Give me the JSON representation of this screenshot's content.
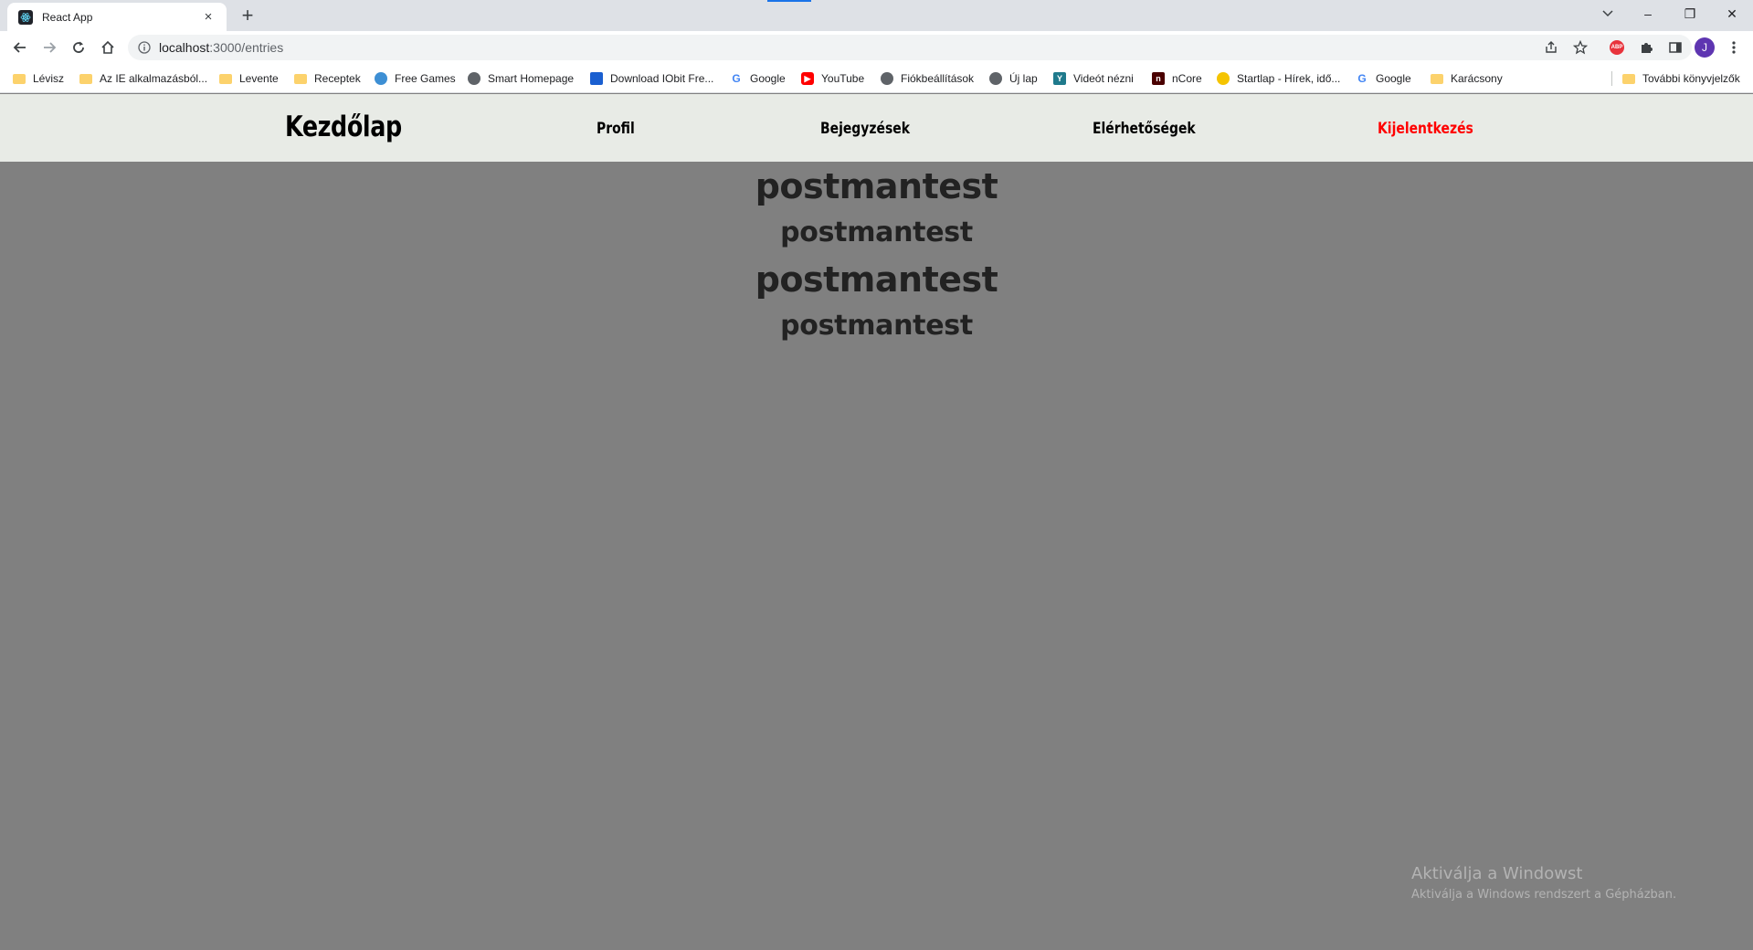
{
  "browser": {
    "tab": {
      "title": "React App",
      "close": "×"
    },
    "new_tab": "+",
    "window_controls": {
      "minimize": "–",
      "restore": "❐",
      "close": "✕"
    },
    "url": {
      "host": "localhost",
      "path": ":3000/entries"
    },
    "profile_initial": "J",
    "abp_label": "ABP",
    "bookmarks": [
      {
        "label": "Lévisz",
        "icon": "folder-icon"
      },
      {
        "label": "Az IE alkalmazásból...",
        "icon": "folder-icon"
      },
      {
        "label": "Levente",
        "icon": "folder-icon"
      },
      {
        "label": "Receptek",
        "icon": "folder-icon"
      },
      {
        "label": "Free Games",
        "icon": "globe-icon"
      },
      {
        "label": "Smart Homepage",
        "icon": "globe-icon"
      },
      {
        "label": "Download IObit Fre...",
        "icon": "iobit-icon"
      },
      {
        "label": "Google",
        "icon": "google-icon"
      },
      {
        "label": "YouTube",
        "icon": "youtube-icon"
      },
      {
        "label": "Fiókbeállítások",
        "icon": "globe-icon"
      },
      {
        "label": "Új lap",
        "icon": "globe-icon"
      },
      {
        "label": "Videót nézni",
        "icon": "y-icon"
      },
      {
        "label": "nCore",
        "icon": "ncore-icon"
      },
      {
        "label": "Startlap - Hírek, idő...",
        "icon": "startlap-icon"
      },
      {
        "label": "Google",
        "icon": "google-icon"
      },
      {
        "label": "Karácsony",
        "icon": "folder-icon"
      }
    ],
    "other_bookmarks": "További könyvjelzők"
  },
  "nav": {
    "home": "Kezdőlap",
    "profile": "Profil",
    "entries": "Bejegyzések",
    "contacts": "Elérhetőségek",
    "logout": "Kijelentkezés"
  },
  "entries": [
    {
      "title": "postmantest",
      "body": "postmantest"
    },
    {
      "title": "postmantest",
      "body": "postmantest"
    }
  ],
  "colors": {
    "page_bg": "#808080",
    "nav_bg": "#e8ebe6",
    "logout": "#ff0000"
  },
  "watermark": {
    "title": "Aktiválja a Windowst",
    "subtitle": "Aktiválja a Windows rendszert a Gépházban."
  }
}
